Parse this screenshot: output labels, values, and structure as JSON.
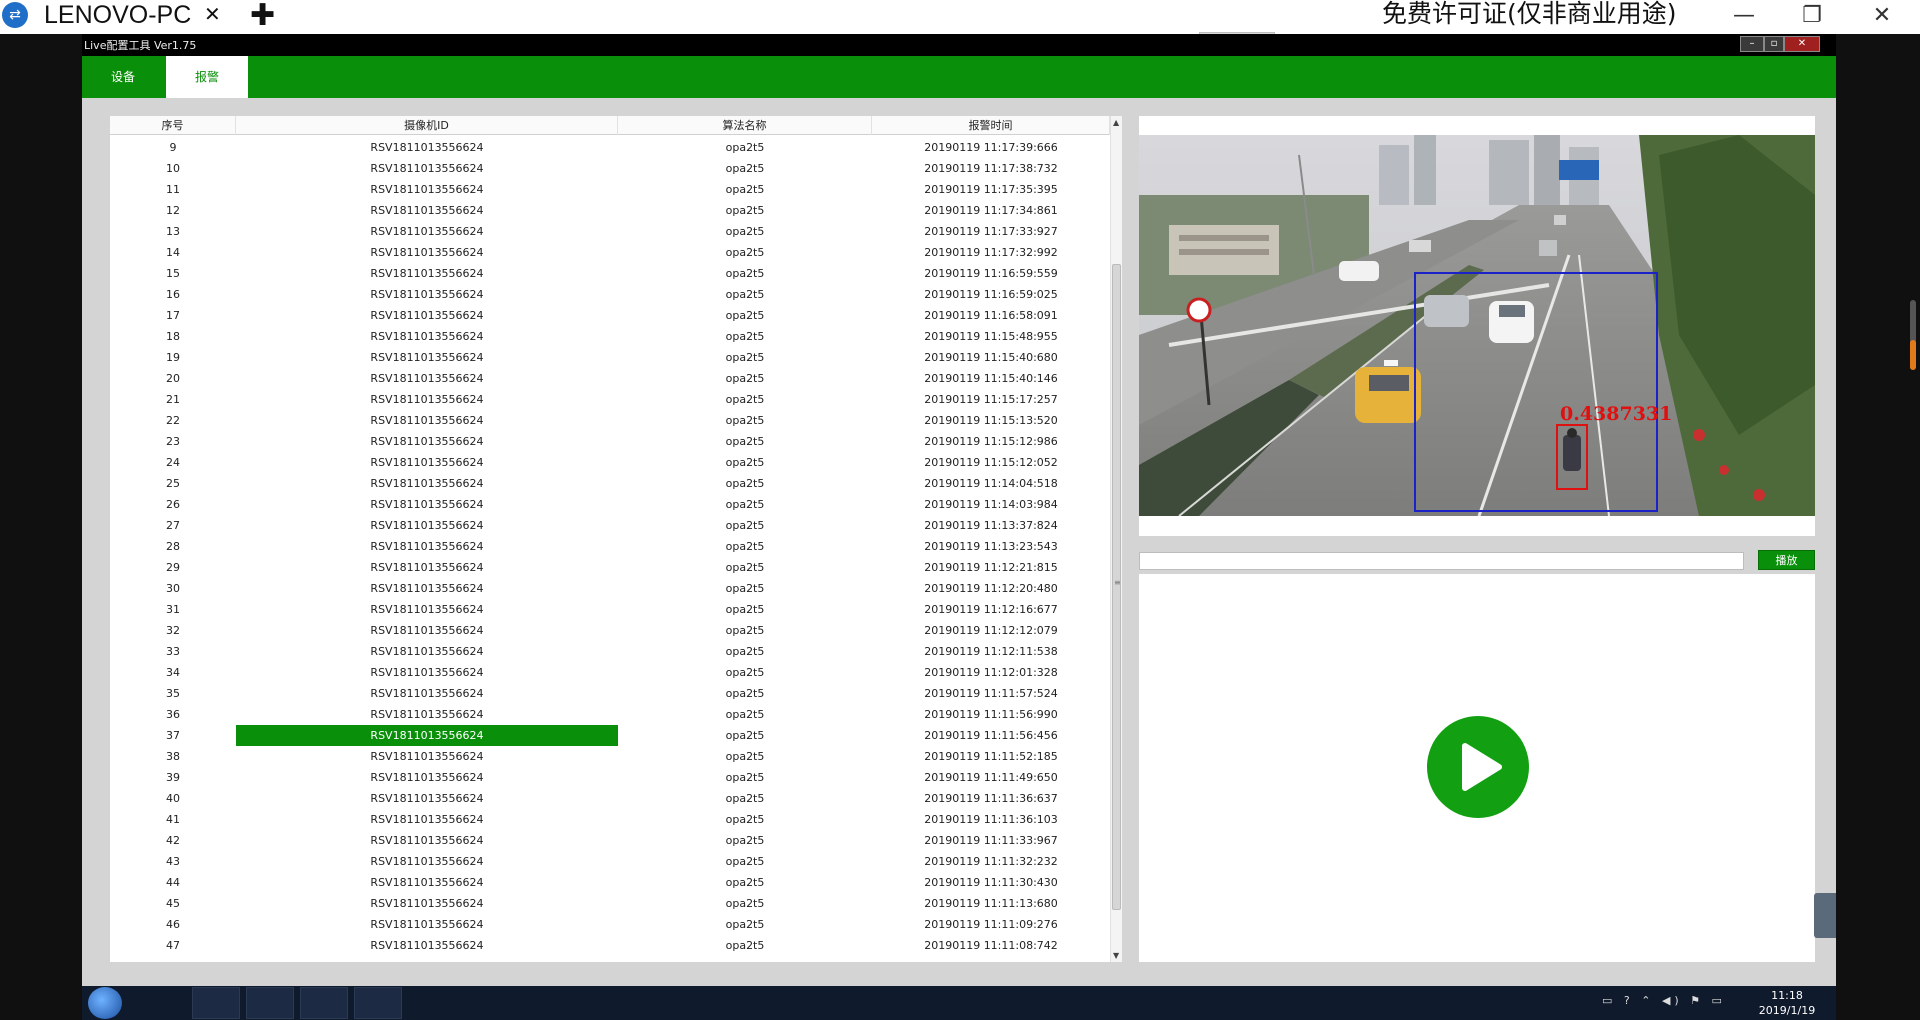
{
  "teamviewer": {
    "tab_title": "LENOVO-PC",
    "close_glyph": "✕",
    "new_tab_glyph": "✚",
    "license_text": "免费许可证(仅非商业用途)",
    "minimize_glyph": "—",
    "restore_glyph": "❐",
    "close_window_glyph": "✕"
  },
  "app": {
    "title": "Live配置工具 Ver1.75",
    "tabs": [
      {
        "label": "设备",
        "active": false
      },
      {
        "label": "报警",
        "active": true
      }
    ]
  },
  "table": {
    "headers": [
      "序号",
      "摄像机ID",
      "算法名称",
      "报警时间"
    ],
    "selected_index": 37,
    "rows": [
      {
        "index": "9",
        "camera_id": "RSV1811013556624",
        "algorithm": "opa2t5",
        "time": "20190119 11:17:39:666"
      },
      {
        "index": "10",
        "camera_id": "RSV1811013556624",
        "algorithm": "opa2t5",
        "time": "20190119 11:17:38:732"
      },
      {
        "index": "11",
        "camera_id": "RSV1811013556624",
        "algorithm": "opa2t5",
        "time": "20190119 11:17:35:395"
      },
      {
        "index": "12",
        "camera_id": "RSV1811013556624",
        "algorithm": "opa2t5",
        "time": "20190119 11:17:34:861"
      },
      {
        "index": "13",
        "camera_id": "RSV1811013556624",
        "algorithm": "opa2t5",
        "time": "20190119 11:17:33:927"
      },
      {
        "index": "14",
        "camera_id": "RSV1811013556624",
        "algorithm": "opa2t5",
        "time": "20190119 11:17:32:992"
      },
      {
        "index": "15",
        "camera_id": "RSV1811013556624",
        "algorithm": "opa2t5",
        "time": "20190119 11:16:59:559"
      },
      {
        "index": "16",
        "camera_id": "RSV1811013556624",
        "algorithm": "opa2t5",
        "time": "20190119 11:16:59:025"
      },
      {
        "index": "17",
        "camera_id": "RSV1811013556624",
        "algorithm": "opa2t5",
        "time": "20190119 11:16:58:091"
      },
      {
        "index": "18",
        "camera_id": "RSV1811013556624",
        "algorithm": "opa2t5",
        "time": "20190119 11:15:48:955"
      },
      {
        "index": "19",
        "camera_id": "RSV1811013556624",
        "algorithm": "opa2t5",
        "time": "20190119 11:15:40:680"
      },
      {
        "index": "20",
        "camera_id": "RSV1811013556624",
        "algorithm": "opa2t5",
        "time": "20190119 11:15:40:146"
      },
      {
        "index": "21",
        "camera_id": "RSV1811013556624",
        "algorithm": "opa2t5",
        "time": "20190119 11:15:17:257"
      },
      {
        "index": "22",
        "camera_id": "RSV1811013556624",
        "algorithm": "opa2t5",
        "time": "20190119 11:15:13:520"
      },
      {
        "index": "23",
        "camera_id": "RSV1811013556624",
        "algorithm": "opa2t5",
        "time": "20190119 11:15:12:986"
      },
      {
        "index": "24",
        "camera_id": "RSV1811013556624",
        "algorithm": "opa2t5",
        "time": "20190119 11:15:12:052"
      },
      {
        "index": "25",
        "camera_id": "RSV1811013556624",
        "algorithm": "opa2t5",
        "time": "20190119 11:14:04:518"
      },
      {
        "index": "26",
        "camera_id": "RSV1811013556624",
        "algorithm": "opa2t5",
        "time": "20190119 11:14:03:984"
      },
      {
        "index": "27",
        "camera_id": "RSV1811013556624",
        "algorithm": "opa2t5",
        "time": "20190119 11:13:37:824"
      },
      {
        "index": "28",
        "camera_id": "RSV1811013556624",
        "algorithm": "opa2t5",
        "time": "20190119 11:13:23:543"
      },
      {
        "index": "29",
        "camera_id": "RSV1811013556624",
        "algorithm": "opa2t5",
        "time": "20190119 11:12:21:815"
      },
      {
        "index": "30",
        "camera_id": "RSV1811013556624",
        "algorithm": "opa2t5",
        "time": "20190119 11:12:20:480"
      },
      {
        "index": "31",
        "camera_id": "RSV1811013556624",
        "algorithm": "opa2t5",
        "time": "20190119 11:12:16:677"
      },
      {
        "index": "32",
        "camera_id": "RSV1811013556624",
        "algorithm": "opa2t5",
        "time": "20190119 11:12:12:079"
      },
      {
        "index": "33",
        "camera_id": "RSV1811013556624",
        "algorithm": "opa2t5",
        "time": "20190119 11:12:11:538"
      },
      {
        "index": "34",
        "camera_id": "RSV1811013556624",
        "algorithm": "opa2t5",
        "time": "20190119 11:12:01:328"
      },
      {
        "index": "35",
        "camera_id": "RSV1811013556624",
        "algorithm": "opa2t5",
        "time": "20190119 11:11:57:524"
      },
      {
        "index": "36",
        "camera_id": "RSV1811013556624",
        "algorithm": "opa2t5",
        "time": "20190119 11:11:56:990"
      },
      {
        "index": "37",
        "camera_id": "RSV1811013556624",
        "algorithm": "opa2t5",
        "time": "20190119 11:11:56:456"
      },
      {
        "index": "38",
        "camera_id": "RSV1811013556624",
        "algorithm": "opa2t5",
        "time": "20190119 11:11:52:185"
      },
      {
        "index": "39",
        "camera_id": "RSV1811013556624",
        "algorithm": "opa2t5",
        "time": "20190119 11:11:49:650"
      },
      {
        "index": "40",
        "camera_id": "RSV1811013556624",
        "algorithm": "opa2t5",
        "time": "20190119 11:11:36:637"
      },
      {
        "index": "41",
        "camera_id": "RSV1811013556624",
        "algorithm": "opa2t5",
        "time": "20190119 11:11:36:103"
      },
      {
        "index": "42",
        "camera_id": "RSV1811013556624",
        "algorithm": "opa2t5",
        "time": "20190119 11:11:33:967"
      },
      {
        "index": "43",
        "camera_id": "RSV1811013556624",
        "algorithm": "opa2t5",
        "time": "20190119 11:11:32:232"
      },
      {
        "index": "44",
        "camera_id": "RSV1811013556624",
        "algorithm": "opa2t5",
        "time": "20190119 11:11:30:430"
      },
      {
        "index": "45",
        "camera_id": "RSV1811013556624",
        "algorithm": "opa2t5",
        "time": "20190119 11:11:13:680"
      },
      {
        "index": "46",
        "camera_id": "RSV1811013556624",
        "algorithm": "opa2t5",
        "time": "20190119 11:11:09:276"
      },
      {
        "index": "47",
        "camera_id": "RSV1811013556624",
        "algorithm": "opa2t5",
        "time": "20190119 11:11:08:742"
      }
    ]
  },
  "detection": {
    "score_label": "0.4387331",
    "box_color": "#1a22c8",
    "target_color": "#e01010"
  },
  "player": {
    "url_value": "",
    "play_label": "播放"
  },
  "taskbar": {
    "time": "11:18",
    "date": "2019/1/19",
    "tray_glyphs": "▭ ? ⌃ ◀) ⚑ ▭"
  },
  "colors": {
    "accent_green": "#0a8f0a",
    "play_green": "#12a012"
  }
}
